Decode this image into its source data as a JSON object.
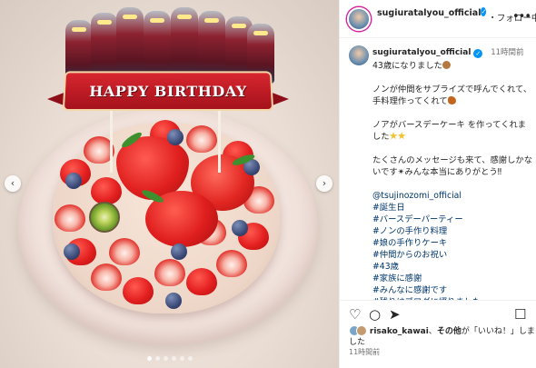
{
  "photo": {
    "banner_text": "HAPPY BIRTHDAY",
    "carousel_dots": 6,
    "active_dot": 0
  },
  "header": {
    "username": "sugiuratalyou_official",
    "follow_label": "・フォロー中",
    "more_icon": "more-horizontal-icon"
  },
  "caption": {
    "username": "sugiuratalyou_official",
    "time": "11時間前",
    "paragraphs": [
      "43歳になりました",
      "ノンが仲間をサプライズで呼んでくれて、手料理作ってくれて",
      "ノアがバースデーケーキ を作ってくれました",
      "たくさんのメッセージも来て、感謝しかないです✴︎みんな本当にありがとう‼︎"
    ],
    "tags": [
      "@tsujinozomi_official",
      "#誕生日",
      "#バースデーパーティー",
      "#ノンの手作り料理",
      "#娘の手作りケーキ",
      "#仲間からのお祝い",
      "#43歳",
      "#家族に感謝",
      "#みんなに感謝です",
      "#残りはブログに綴りました"
    ]
  },
  "actions": {
    "like_icon": "heart-icon",
    "comment_icon": "comment-icon",
    "share_icon": "share-icon",
    "save_icon": "bookmark-icon"
  },
  "likes": {
    "user": "risako_kawai",
    "text_mid": "、",
    "others": "その他",
    "suffix": "が「いいね！」しました"
  },
  "post_time": "11時間前",
  "colors": {
    "verified": "#0095f6",
    "link": "#00376b",
    "banner": "#d8262f"
  }
}
